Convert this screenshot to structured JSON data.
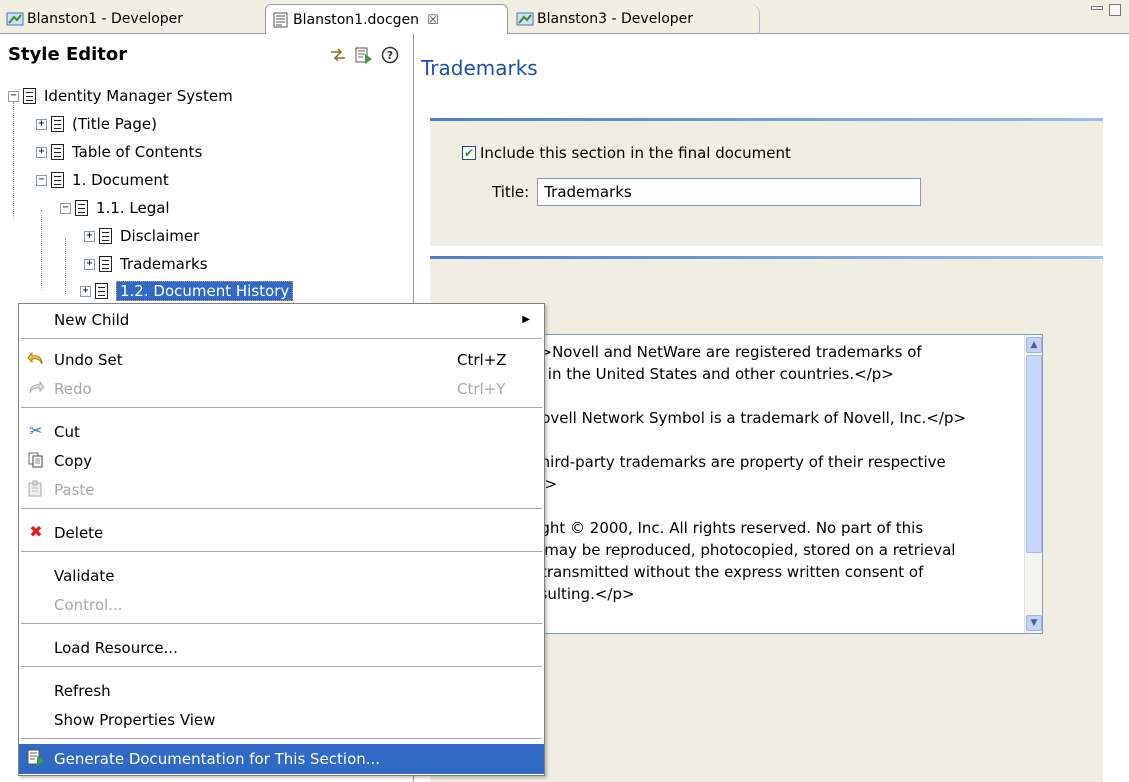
{
  "tabs": [
    {
      "label": "Blanston1 - Developer",
      "icon": "developer-icon"
    },
    {
      "label": "Blanston1.docgen",
      "icon": "docgen-icon",
      "active": true
    },
    {
      "label": "Blanston3 - Developer",
      "icon": "developer-icon"
    }
  ],
  "style_editor": {
    "title": "Style Editor",
    "tree": [
      {
        "label": "Identity Manager System",
        "expander": "−"
      },
      {
        "label": "(Title Page)",
        "expander": "+"
      },
      {
        "label": "Table of Contents",
        "expander": "+"
      },
      {
        "label": "1. Document",
        "expander": "−"
      },
      {
        "label": "1.1. Legal",
        "expander": "−"
      },
      {
        "label": "Disclaimer",
        "expander": "+"
      },
      {
        "label": "Trademarks",
        "expander": "+"
      },
      {
        "label": "1.2. Document History",
        "expander": "+",
        "selected": true
      }
    ]
  },
  "editor": {
    "heading": "Trademarks",
    "include_label": "Include this section in the final document",
    "include_checked": true,
    "title_label": "Title:",
    "title_value": "Trademarks",
    "content": "p>Novell and NetWare are registered trademarks of\nc. in the United States and other countries.</p>\n\nNovell Network Symbol is a trademark of Novell, Inc.</p>\n\n third-party trademarks are property of their respective\n/p>\n\nright © 2000, Inc. All rights reserved. No part of this\nn may be reproduced, photocopied, stored on a retrieval\nr transmitted without the express written consent of\nnsulting.</p>"
  },
  "context_menu": {
    "new_child": "New Child",
    "undo": {
      "label": "Undo Set",
      "shortcut": "Ctrl+Z"
    },
    "redo": {
      "label": "Redo",
      "shortcut": "Ctrl+Y"
    },
    "cut": "Cut",
    "copy": "Copy",
    "paste": "Paste",
    "delete": "Delete",
    "validate": "Validate",
    "control": "Control...",
    "load_resource": "Load Resource...",
    "refresh": "Refresh",
    "show_properties": "Show Properties View",
    "generate": "Generate Documentation for This Section..."
  },
  "colors": {
    "selection": "#316ac5",
    "heading": "#1c51a5",
    "section_bg": "#f0eee3",
    "delete_icon": "#e02020"
  }
}
